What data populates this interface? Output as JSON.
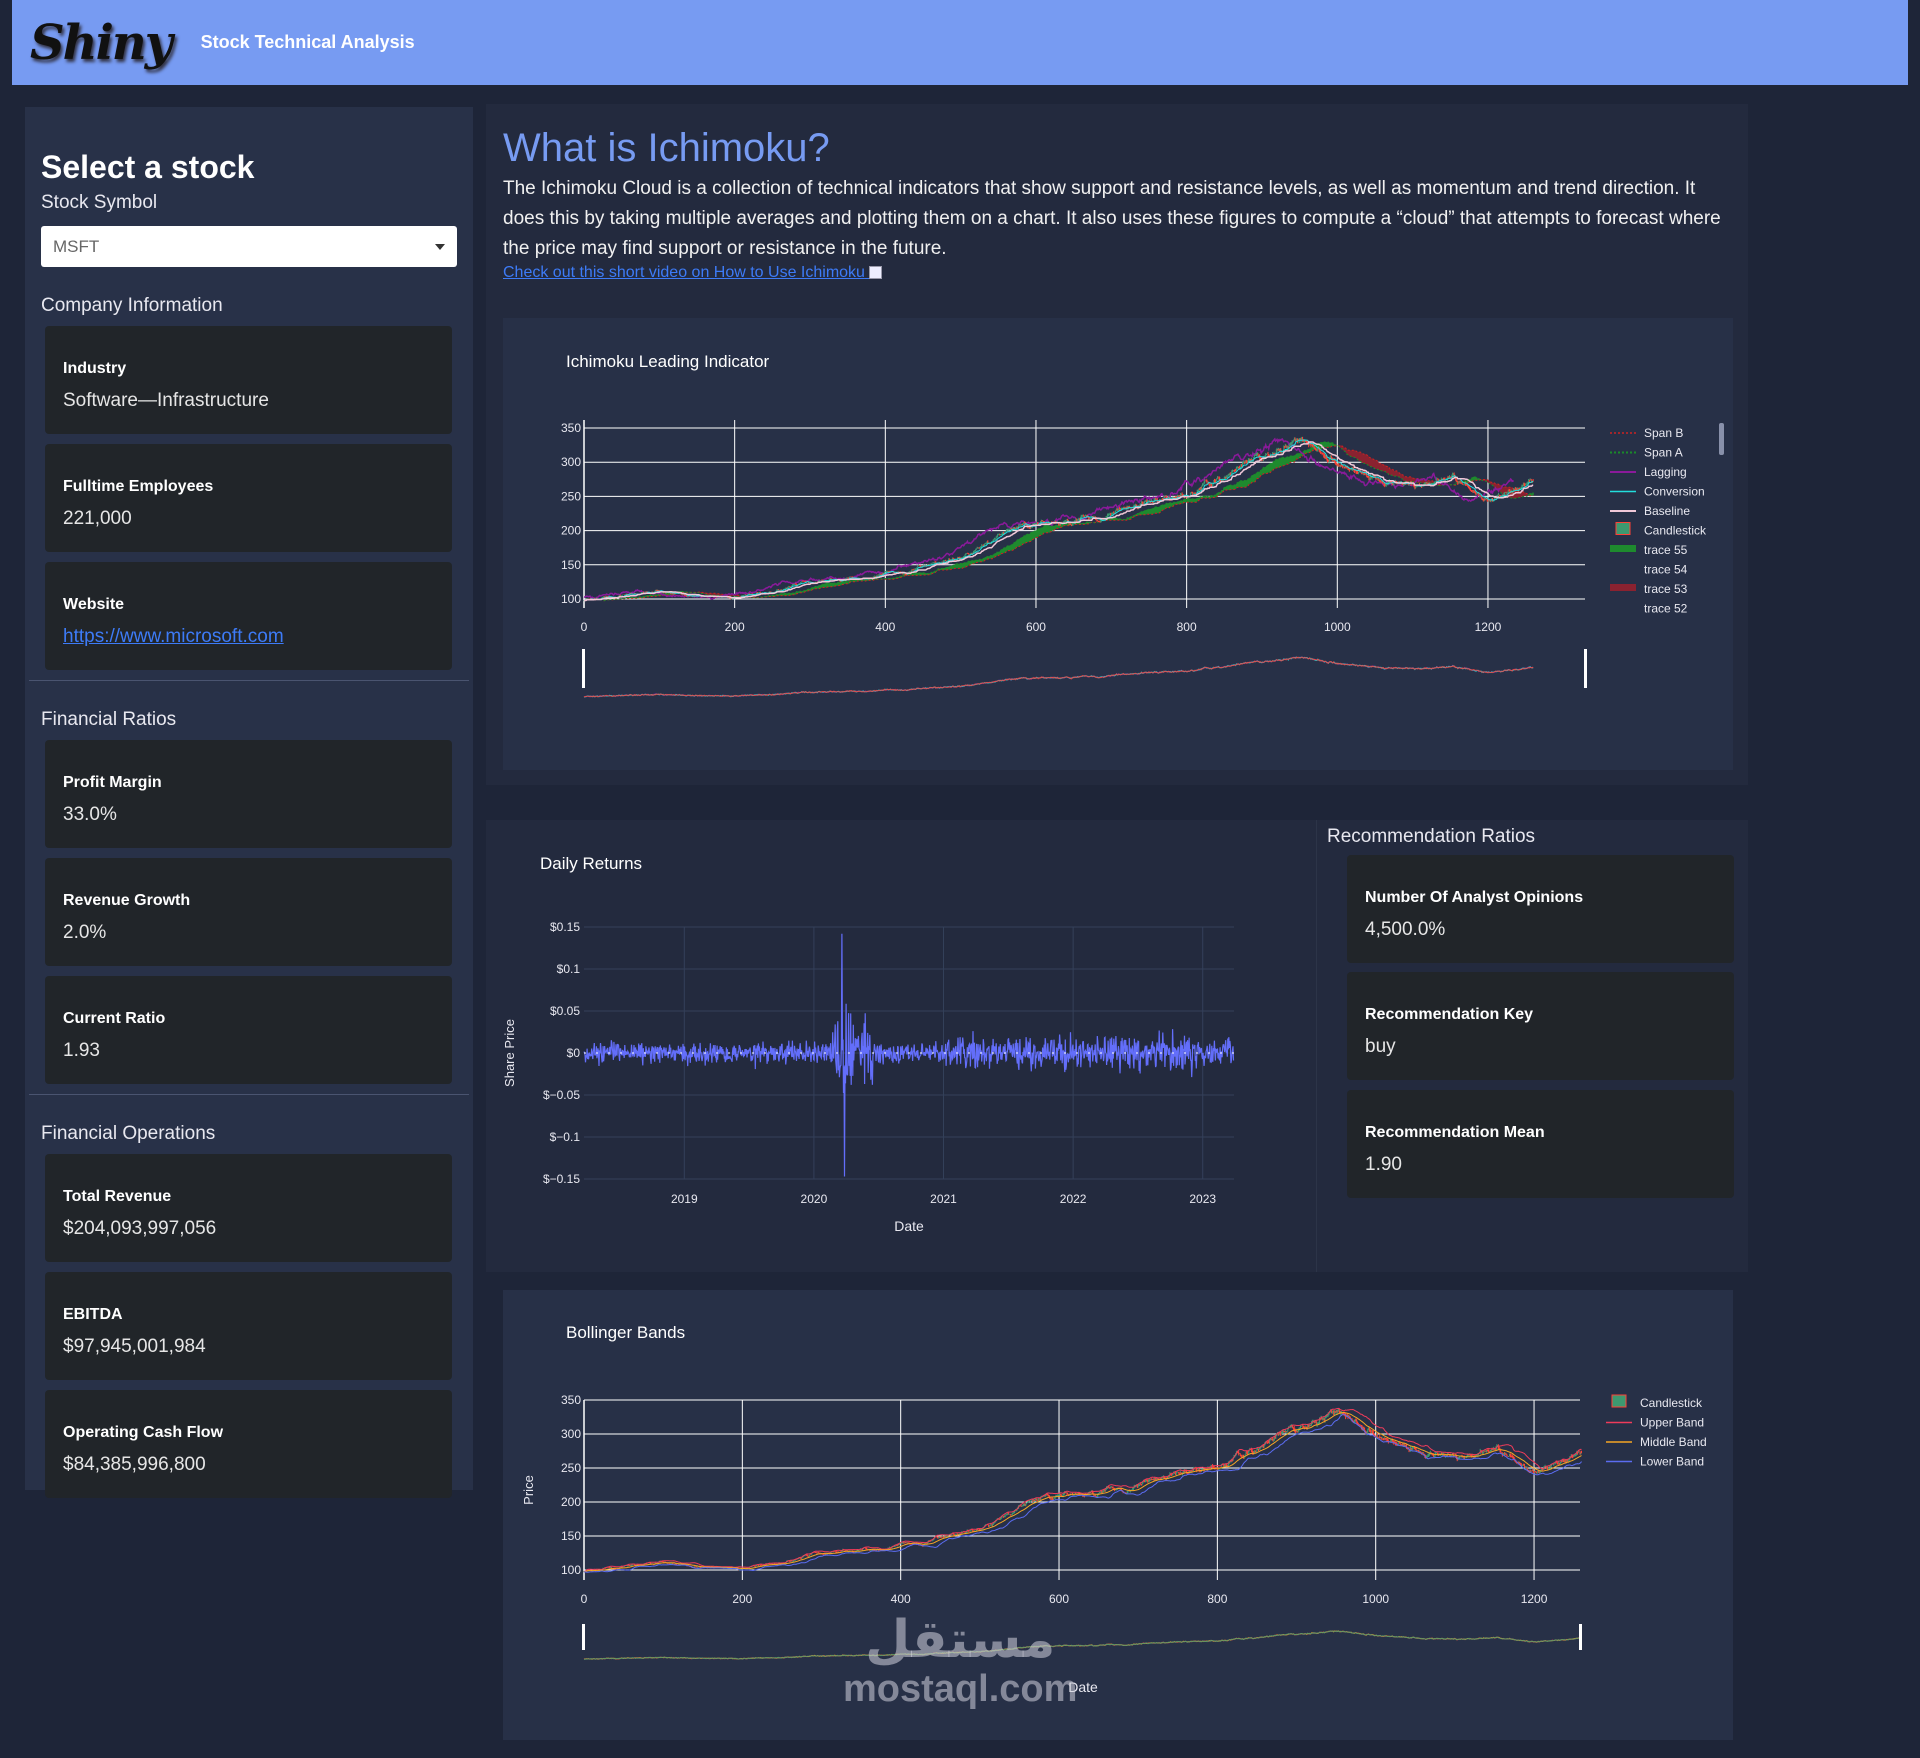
{
  "header": {
    "logo": "Shiny",
    "title": "Stock Technical Analysis"
  },
  "sidebar": {
    "heading": "Select a stock",
    "symbol_label": "Stock Symbol",
    "symbol_value": "MSFT",
    "company_label": "Company Information",
    "company": [
      {
        "title": "Industry",
        "value": "Software—Infrastructure"
      },
      {
        "title": "Fulltime Employees",
        "value": "221,000"
      },
      {
        "title": "Website",
        "value": "https://www.microsoft.com"
      }
    ],
    "ratios_label": "Financial Ratios",
    "ratios": [
      {
        "title": "Profit Margin",
        "value": "33.0%"
      },
      {
        "title": "Revenue Growth",
        "value": "2.0%"
      },
      {
        "title": "Current Ratio",
        "value": "1.93"
      }
    ],
    "ops_label": "Financial Operations",
    "ops": [
      {
        "title": "Total Revenue",
        "value": "$204,093,997,056"
      },
      {
        "title": "EBITDA",
        "value": "$97,945,001,984"
      },
      {
        "title": "Operating Cash Flow",
        "value": "$84,385,996,800"
      }
    ]
  },
  "intro": {
    "title": "What is Ichimoku?",
    "text": "The Ichimoku Cloud is a collection of technical indicators that show support and resistance levels, as well as momentum and trend direction. It does this by taking multiple averages and plotting them on a chart. It also uses these figures to compute a “cloud” that attempts to forecast where the price may find support or resistance in the future.",
    "link": "Check out this short video on How to Use Ichimoku"
  },
  "recommendation": {
    "heading": "Recommendation Ratios",
    "cards": [
      {
        "title": "Number Of Analyst Opinions",
        "value": "4,500.0%"
      },
      {
        "title": "Recommendation Key",
        "value": "buy"
      },
      {
        "title": "Recommendation Mean",
        "value": "1.90"
      }
    ]
  },
  "watermark": {
    "arabic": "مستقل",
    "latin": "mostaql.com"
  },
  "chart_data": [
    {
      "type": "line",
      "title": "Ichimoku Leading Indicator",
      "xlabel": "",
      "ylabel": "",
      "xlim": [
        0,
        1330
      ],
      "ylim": [
        90,
        360
      ],
      "xticks": [
        0,
        200,
        400,
        600,
        800,
        1000,
        1200
      ],
      "yticks": [
        100,
        150,
        200,
        250,
        300,
        350
      ],
      "legend": [
        "Span B",
        "Span A",
        "Lagging",
        "Conversion",
        "Baseline",
        "Candlestick",
        "trace 55",
        "trace 54",
        "trace 53",
        "trace 52"
      ],
      "legend_position": "right",
      "price_keypoints": {
        "x": [
          0,
          50,
          100,
          150,
          200,
          250,
          300,
          350,
          400,
          450,
          500,
          550,
          600,
          650,
          700,
          750,
          800,
          850,
          900,
          950,
          1000,
          1050,
          1100,
          1150,
          1200,
          1260
        ],
        "y": [
          98,
          104,
          110,
          106,
          100,
          112,
          122,
          130,
          136,
          148,
          162,
          192,
          210,
          214,
          224,
          240,
          252,
          282,
          300,
          338,
          300,
          284,
          262,
          280,
          245,
          265
        ]
      },
      "colors": {
        "spanB": "#cc2222",
        "spanA": "#1a8a2a",
        "lagging": "#8a1a9a",
        "conversion": "#22dddd",
        "baseline": "#f0c8d8",
        "up": "#3d9970",
        "down": "#ff4136",
        "cloud_up": "#1e8a2e",
        "cloud_down": "#8a2230"
      }
    },
    {
      "type": "line",
      "title": "Daily Returns",
      "xlabel": "Date",
      "ylabel": "Share Price",
      "ylim": [
        -0.15,
        0.15
      ],
      "xticks": [
        "2019",
        "2020",
        "2021",
        "2022",
        "2023"
      ],
      "yticks": [
        "$0.15",
        "$0.1",
        "$0.05",
        "$0",
        "$−0.05",
        "$−0.1",
        "$−0.15"
      ],
      "date_range": [
        "2018-03",
        "2023-03"
      ],
      "min": -0.147,
      "max": 0.142,
      "color": "#636efa"
    },
    {
      "type": "line",
      "title": "Bollinger Bands",
      "xlabel": "Date",
      "ylabel": "Price",
      "xlim": [
        0,
        1260
      ],
      "ylim": [
        90,
        360
      ],
      "xticks": [
        0,
        200,
        400,
        600,
        800,
        1000,
        1200
      ],
      "yticks": [
        100,
        150,
        200,
        250,
        300,
        350
      ],
      "legend": [
        "Candlestick",
        "Upper Band",
        "Middle Band",
        "Lower Band"
      ],
      "legend_position": "right",
      "colors": {
        "upper": "#ef3b5a",
        "middle": "#f5a623",
        "lower": "#5b6cf0"
      }
    }
  ]
}
